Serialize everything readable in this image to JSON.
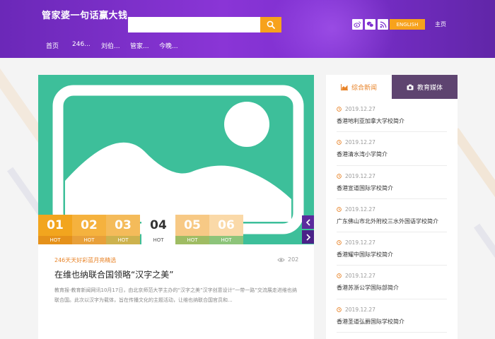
{
  "header": {
    "logo": "管家婆一句话赢大钱",
    "search": {
      "placeholder": "",
      "value": ""
    },
    "social": [
      "weibo-icon",
      "wechat-icon",
      "rss-icon"
    ],
    "lang_button": "ENGLISH",
    "home_link": "主页"
  },
  "nav": {
    "items": [
      {
        "label": "首页"
      },
      {
        "label": "246..."
      },
      {
        "label": "刘伯..."
      },
      {
        "label": "管家..."
      },
      {
        "label": "今晚..."
      }
    ]
  },
  "slider": {
    "tabs": [
      {
        "num": "01",
        "hot": "HOT",
        "color": "#f2a51e",
        "hot_bg": "#e5911a"
      },
      {
        "num": "02",
        "hot": "HOT",
        "color": "#f5b23e",
        "hot_bg": "#e8a03a"
      },
      {
        "num": "03",
        "hot": "HOT",
        "color": "#f4bb5a",
        "hot_bg": "#cdb24e"
      },
      {
        "num": "04",
        "hot": "HOT",
        "color": "#ffffff",
        "hot_bg": "#ffffff"
      },
      {
        "num": "05",
        "hot": "HOT",
        "color": "#f7c985",
        "hot_bg": "#9fbc63"
      },
      {
        "num": "06",
        "hot": "HOT",
        "color": "#fad9a8",
        "hot_bg": "#8dc47a"
      }
    ],
    "active_index": 3,
    "bg_color": "#3dbf9a"
  },
  "article": {
    "tag": "246天天好彩蓝月亮精选",
    "views": "202",
    "title": "在维也纳联合国领略“汉字之美”",
    "excerpt": "教育报-教育新闻网讯10月17日，由北京师范大学主办的“汉字之美”汉字创意设计“一带一路”交流展走进维也纳联合国。此次以汉字为载体，旨在传播文化的主题活动，让维也纳联合国官员和..."
  },
  "sidebar": {
    "tabs": [
      {
        "label": "综合新闻",
        "icon": "chart-icon"
      },
      {
        "label": "教育媒体",
        "icon": "camera-icon"
      }
    ],
    "news": [
      {
        "date": "2019.12.27",
        "title": "香港地利亚加拿大学校简介"
      },
      {
        "date": "2019.12.27",
        "title": "香港清水湾小学简介"
      },
      {
        "date": "2019.12.27",
        "title": "香港宣道国际学校简介"
      },
      {
        "date": "2019.12.27",
        "title": "广东佛山市北外附校三水外国语学校简介"
      },
      {
        "date": "2019.12.27",
        "title": "香港耀中国际学校简介"
      },
      {
        "date": "2019.12.27",
        "title": "香港苏浙公学国际部简介"
      },
      {
        "date": "2019.12.27",
        "title": "香港圣道弘爵国际学校简介"
      }
    ]
  },
  "colors": {
    "accent": "#f7a21c",
    "header_purple": "#7d2fd0",
    "sidebar_tab_bg": "#5e4470"
  }
}
